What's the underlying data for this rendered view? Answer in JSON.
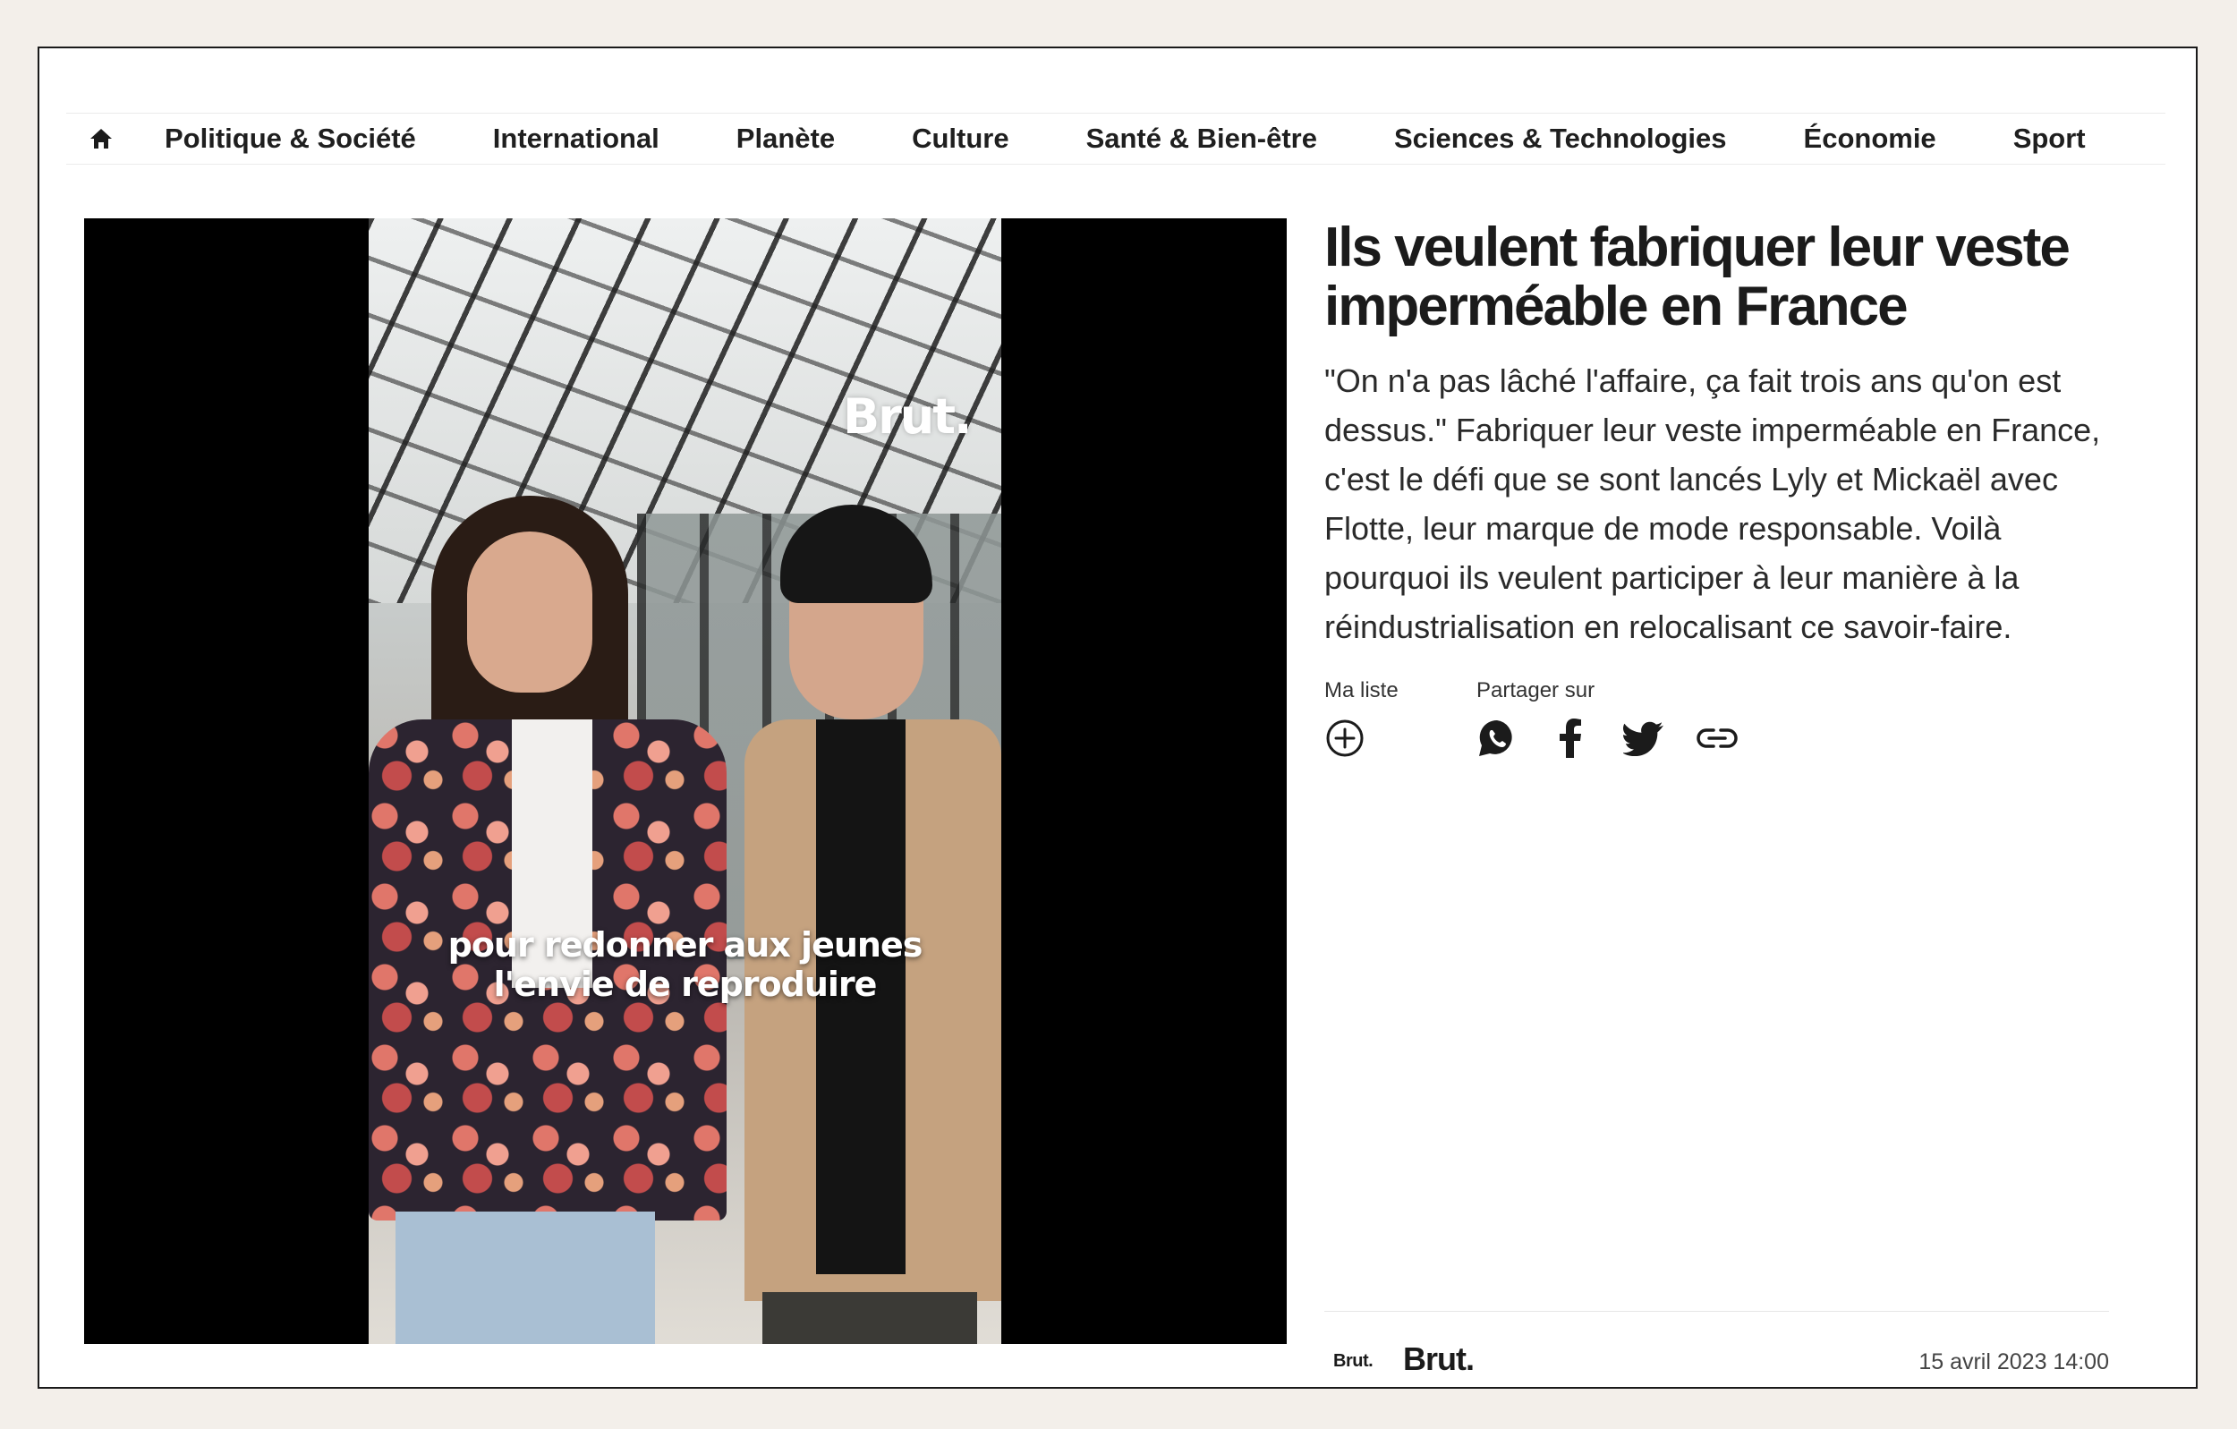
{
  "nav": {
    "home_icon": "home-icon",
    "items": [
      {
        "label": "Politique & Société"
      },
      {
        "label": "International"
      },
      {
        "label": "Planète"
      },
      {
        "label": "Culture"
      },
      {
        "label": "Santé & Bien-être"
      },
      {
        "label": "Sciences & Technologies"
      },
      {
        "label": "Économie"
      },
      {
        "label": "Sport"
      }
    ]
  },
  "video": {
    "watermark": "Brut.",
    "subtitle_line1": "pour redonner aux jeunes",
    "subtitle_line2": "l'envie de reproduire"
  },
  "article": {
    "title": "Ils veulent fabriquer leur veste imperméable en France",
    "description": "\"On n'a pas lâché l'affaire, ça fait trois ans qu'on est dessus.\" Fabriquer leur veste imperméable en France, c'est le défi que se sont lancés Lyly et Mickaël avec Flotte, leur marque de mode responsable. Voilà pourquoi ils veulent participer à leur manière à la réindustrialisation en relocalisant ce savoir-faire.",
    "my_list_label": "Ma liste",
    "share_label": "Partager sur",
    "share_icons": [
      "whatsapp-icon",
      "facebook-icon",
      "twitter-icon",
      "link-icon"
    ]
  },
  "footer": {
    "logo_small": "Brut.",
    "brand": "Brut.",
    "date": "15 avril 2023 14:00"
  },
  "colors": {
    "page_background": "#f3efea",
    "text": "#1f1f1f",
    "video_background": "#000000"
  }
}
